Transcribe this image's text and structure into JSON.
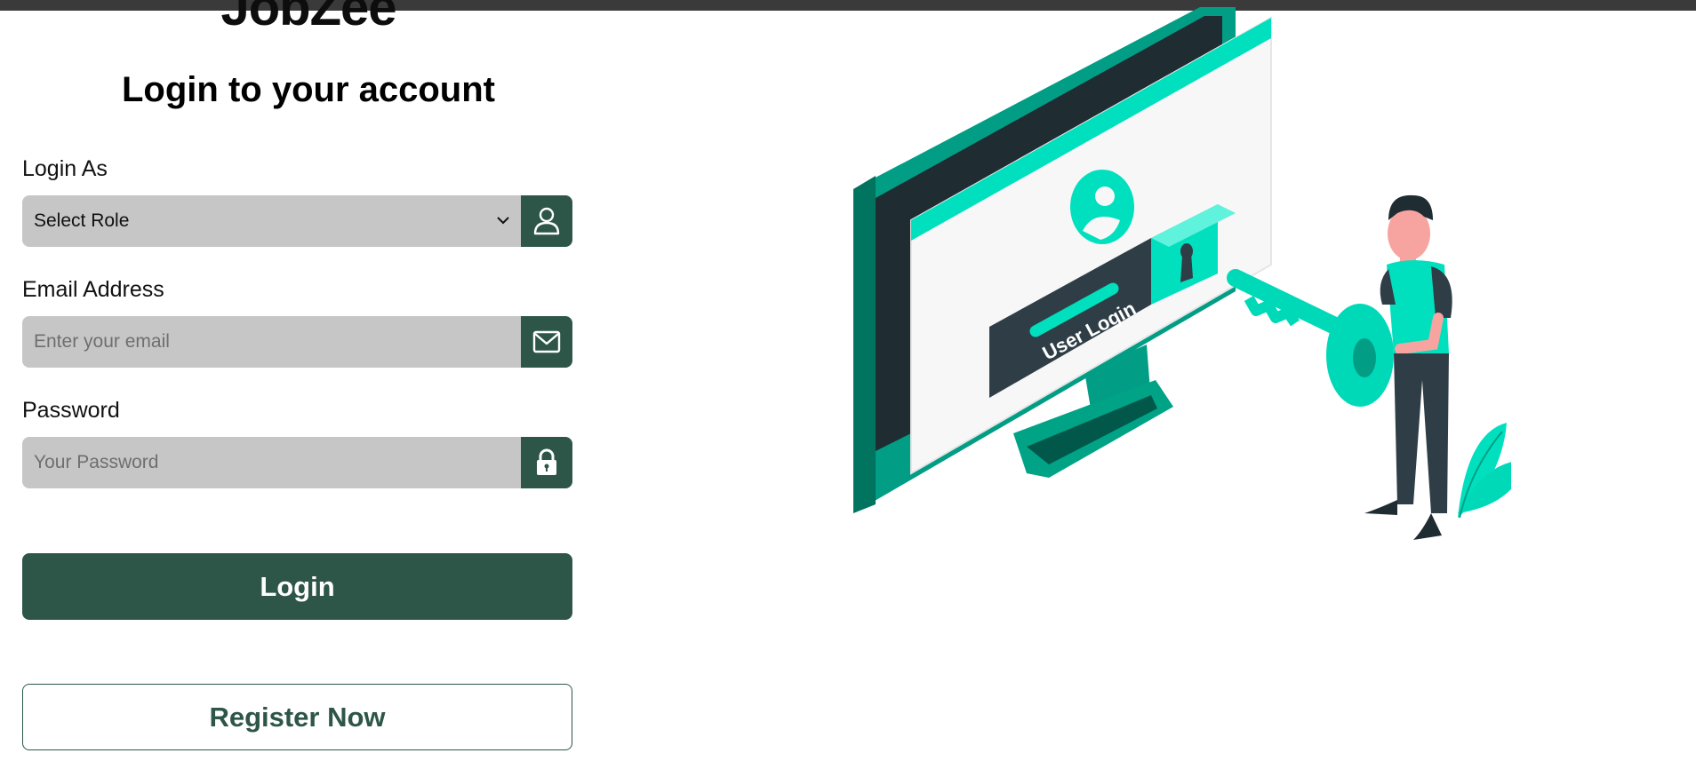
{
  "brand": {
    "logo": "JobZee"
  },
  "form": {
    "title": "Login to your account",
    "role": {
      "label": "Login As",
      "value": "Select Role",
      "icon": "user-icon"
    },
    "email": {
      "label": "Email Address",
      "placeholder": "Enter your email",
      "icon": "mail-icon"
    },
    "password": {
      "label": "Password",
      "placeholder": "Your Password",
      "icon": "lock-icon"
    },
    "login_button": "Login",
    "register_button": "Register Now"
  },
  "illustration": {
    "caption": "User Login"
  },
  "colors": {
    "primary": "#2d5648",
    "field_bg": "#c6c6c6",
    "accent": "#00e0be"
  }
}
